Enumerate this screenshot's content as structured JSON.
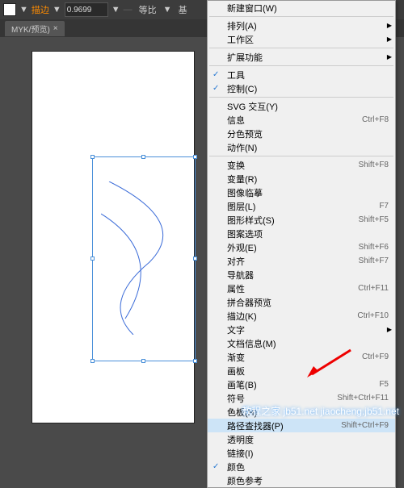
{
  "toolbar": {
    "stroke_label": "描边",
    "stroke_value": "0.9699",
    "scale_label": "等比",
    "base_label": "基",
    "sep": "▼"
  },
  "tab": {
    "name": "MYK/预览)",
    "close": "×"
  },
  "menu": {
    "items": [
      {
        "label": "新建窗口(W)",
        "shortcut": "",
        "sub": false,
        "sep_after": true
      },
      {
        "label": "排列(A)",
        "shortcut": "",
        "sub": true
      },
      {
        "label": "工作区",
        "shortcut": "",
        "sub": true,
        "sep_after": true
      },
      {
        "label": "扩展功能",
        "shortcut": "",
        "sub": true,
        "sep_after": true
      },
      {
        "label": "工具",
        "shortcut": "",
        "checked": true
      },
      {
        "label": "控制(C)",
        "shortcut": "",
        "checked": true,
        "sep_after": true
      },
      {
        "label": "SVG 交互(Y)",
        "shortcut": ""
      },
      {
        "label": "信息",
        "shortcut": "Ctrl+F8"
      },
      {
        "label": "分色预览",
        "shortcut": ""
      },
      {
        "label": "动作(N)",
        "shortcut": "",
        "sep_after": true
      },
      {
        "label": "变换",
        "shortcut": "Shift+F8"
      },
      {
        "label": "变量(R)",
        "shortcut": ""
      },
      {
        "label": "图像临摹",
        "shortcut": ""
      },
      {
        "label": "图层(L)",
        "shortcut": "F7"
      },
      {
        "label": "图形样式(S)",
        "shortcut": "Shift+F5"
      },
      {
        "label": "图案选项",
        "shortcut": ""
      },
      {
        "label": "外观(E)",
        "shortcut": "Shift+F6"
      },
      {
        "label": "对齐",
        "shortcut": "Shift+F7"
      },
      {
        "label": "导航器",
        "shortcut": ""
      },
      {
        "label": "属性",
        "shortcut": "Ctrl+F11"
      },
      {
        "label": "拼合器预览",
        "shortcut": ""
      },
      {
        "label": "描边(K)",
        "shortcut": "Ctrl+F10"
      },
      {
        "label": "文字",
        "shortcut": "",
        "sub": true
      },
      {
        "label": "文档信息(M)",
        "shortcut": ""
      },
      {
        "label": "渐变",
        "shortcut": "Ctrl+F9"
      },
      {
        "label": "画板",
        "shortcut": ""
      },
      {
        "label": "画笔(B)",
        "shortcut": "F5"
      },
      {
        "label": "符号",
        "shortcut": "Shift+Ctrl+F11"
      },
      {
        "label": "色板(H)",
        "shortcut": ""
      },
      {
        "label": "路径查找器(P)",
        "shortcut": "Shift+Ctrl+F9",
        "highlighted": true
      },
      {
        "label": "透明度",
        "shortcut": ""
      },
      {
        "label": "链接(I)",
        "shortcut": ""
      },
      {
        "label": "颜色",
        "shortcut": "",
        "checked": true
      },
      {
        "label": "颜色参考",
        "shortcut": ""
      }
    ]
  },
  "watermarks": {
    "w1": "脚本之家教程",
    "w2": "教程之家 jb51.net\njiaocheng.jb51.net"
  }
}
